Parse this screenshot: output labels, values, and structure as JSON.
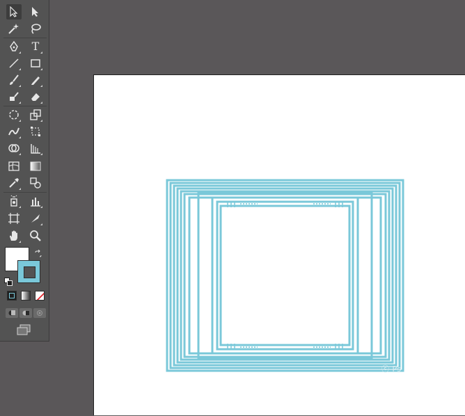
{
  "app": {
    "tools_panel": {
      "tools": [
        {
          "name": "selection-tool",
          "icon": "arrow-outline-icon",
          "selected": true
        },
        {
          "name": "direct-selection-tool",
          "icon": "arrow-solid-icon"
        },
        {
          "name": "magic-wand-tool",
          "icon": "magic-wand-icon"
        },
        {
          "name": "lasso-tool",
          "icon": "lasso-icon"
        },
        {
          "name": "pen-tool",
          "icon": "pen-icon"
        },
        {
          "name": "type-tool",
          "icon": "type-icon",
          "glyph": "T"
        },
        {
          "name": "line-segment-tool",
          "icon": "line-icon"
        },
        {
          "name": "rectangle-tool",
          "icon": "rectangle-icon"
        },
        {
          "name": "paintbrush-tool",
          "icon": "brush-icon"
        },
        {
          "name": "pencil-tool",
          "icon": "pencil-icon"
        },
        {
          "name": "blob-brush-tool",
          "icon": "blob-brush-icon"
        },
        {
          "name": "eraser-tool",
          "icon": "eraser-icon"
        },
        {
          "name": "rotate-tool",
          "icon": "rotate-icon"
        },
        {
          "name": "scale-tool",
          "icon": "scale-icon"
        },
        {
          "name": "warp-tool",
          "icon": "warp-icon"
        },
        {
          "name": "free-transform-tool",
          "icon": "free-transform-icon"
        },
        {
          "name": "shape-builder-tool",
          "icon": "shape-builder-icon"
        },
        {
          "name": "perspective-grid-tool",
          "icon": "perspective-grid-icon"
        },
        {
          "name": "mesh-tool",
          "icon": "mesh-icon"
        },
        {
          "name": "gradient-tool",
          "icon": "gradient-icon"
        },
        {
          "name": "eyedropper-tool",
          "icon": "eyedropper-icon"
        },
        {
          "name": "blend-tool",
          "icon": "blend-icon"
        },
        {
          "name": "symbol-sprayer-tool",
          "icon": "symbol-sprayer-icon"
        },
        {
          "name": "column-graph-tool",
          "icon": "column-graph-icon"
        },
        {
          "name": "artboard-tool",
          "icon": "artboard-icon"
        },
        {
          "name": "slice-tool",
          "icon": "slice-icon"
        },
        {
          "name": "hand-tool",
          "icon": "hand-icon"
        },
        {
          "name": "zoom-tool",
          "icon": "zoom-icon"
        }
      ],
      "fill_color": "#ffffff",
      "stroke_color": "#7ac8d9",
      "modes": [
        "color-mode",
        "gradient-mode",
        "none-mode"
      ],
      "draw_modes": [
        "draw-normal",
        "draw-behind",
        "draw-inside"
      ],
      "screen_mode": "screen-mode-icon"
    },
    "canvas": {
      "background": "#5a5759",
      "artboard_color": "#ffffff",
      "shape_stroke_color": "#7ac8d9"
    },
    "watermark_text": "ⓒ Ps"
  }
}
